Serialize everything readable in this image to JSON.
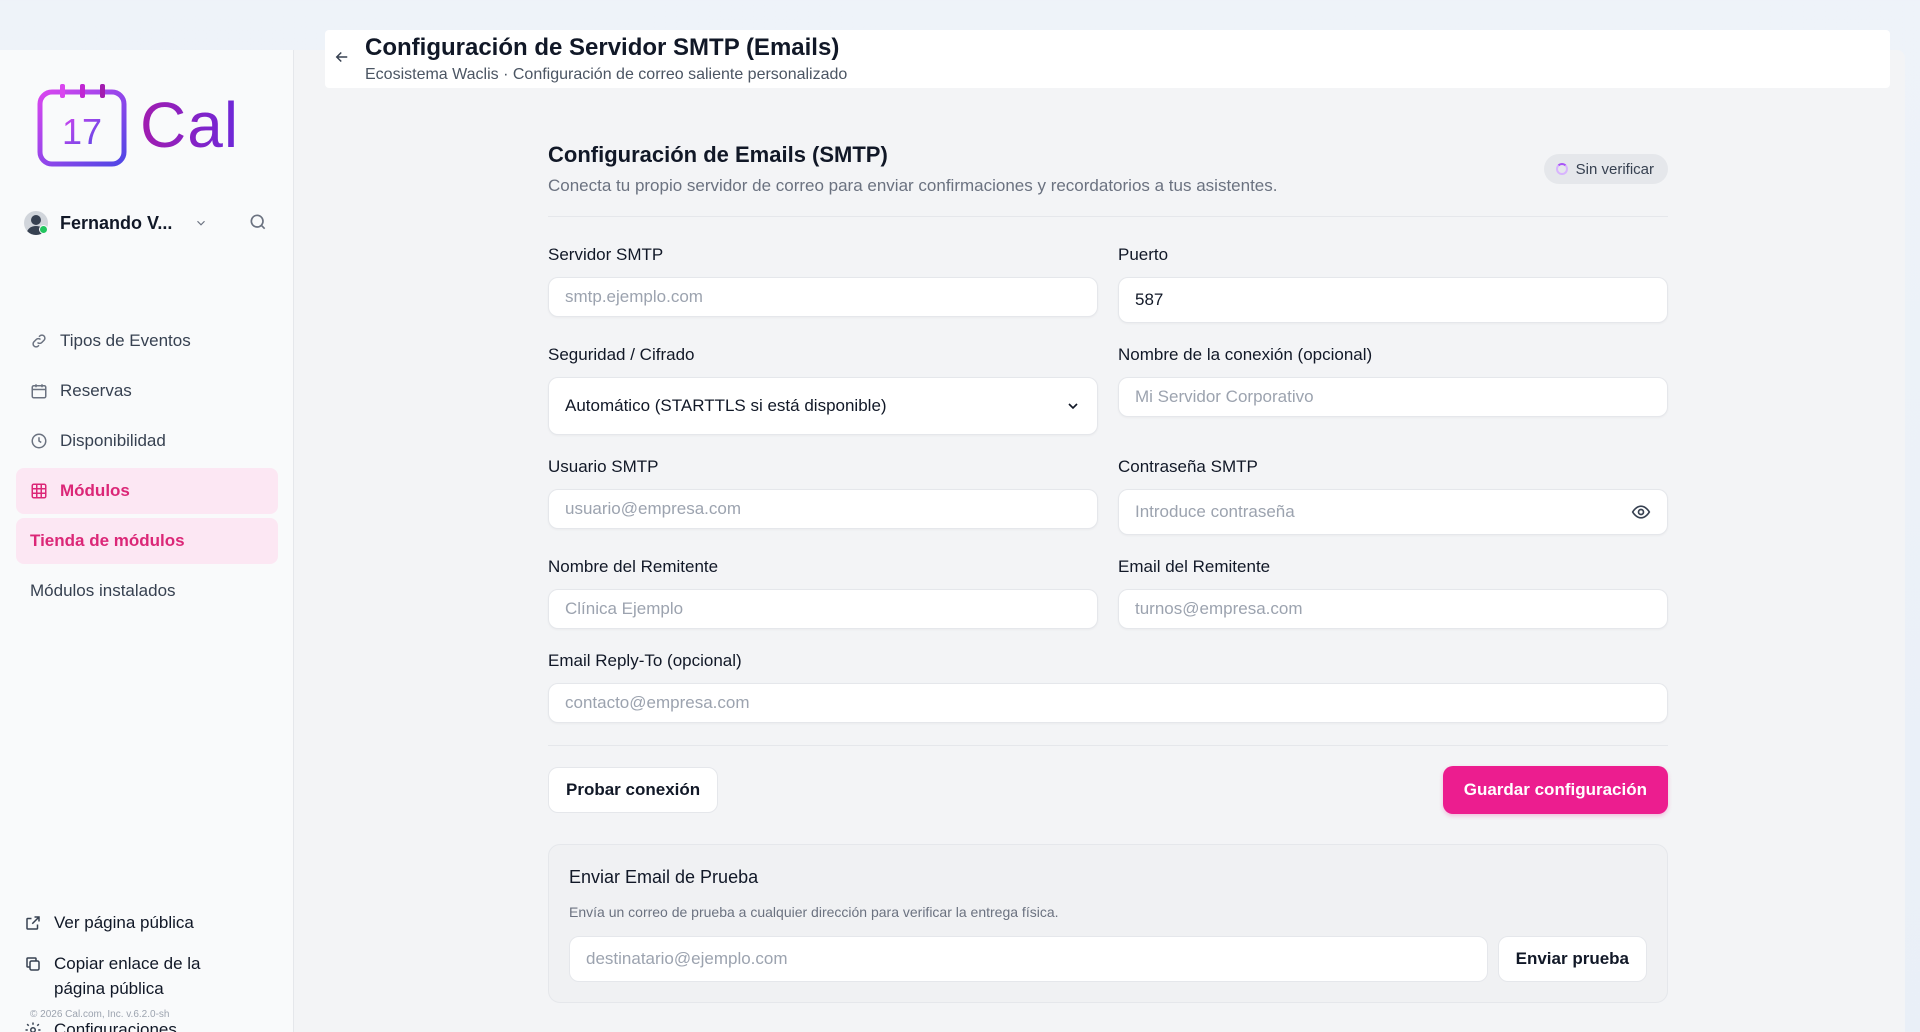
{
  "brand": {
    "name": "Cal",
    "day": "17"
  },
  "user": {
    "name": "Fernando V..."
  },
  "nav": [
    {
      "label": "Tipos de Eventos",
      "icon": "link-icon"
    },
    {
      "label": "Reservas",
      "icon": "calendar-icon"
    },
    {
      "label": "Disponibilidad",
      "icon": "clock-icon"
    },
    {
      "label": "Módulos",
      "icon": "grid-icon"
    }
  ],
  "subnav": [
    {
      "label": "Tienda de módulos"
    },
    {
      "label": "Módulos instalados"
    }
  ],
  "bottom_nav": [
    {
      "label": "Ver página pública"
    },
    {
      "label": "Copiar enlace de la página pública"
    },
    {
      "label": "Configuraciones"
    }
  ],
  "copyright": "© 2026 Cal.com, Inc. v.6.2.0-sh",
  "header": {
    "title": "Configuración de Servidor SMTP (Emails)",
    "subtitle": "Ecosistema Waclis · Configuración de correo saliente personalizado"
  },
  "section": {
    "title": "Configuración de Emails (SMTP)",
    "subtitle": "Conecta tu propio servidor de correo para enviar confirmaciones y recordatorios a tus asistentes.",
    "status": "Sin verificar"
  },
  "fields": {
    "server": {
      "label": "Servidor SMTP",
      "placeholder": "smtp.ejemplo.com"
    },
    "port": {
      "label": "Puerto",
      "value": "587"
    },
    "security": {
      "label": "Seguridad / Cifrado",
      "value": "Automático (STARTTLS si está disponible)"
    },
    "conn_name": {
      "label": "Nombre de la conexión (opcional)",
      "placeholder": "Mi Servidor Corporativo"
    },
    "user": {
      "label": "Usuario SMTP",
      "placeholder": "usuario@empresa.com"
    },
    "password": {
      "label": "Contraseña SMTP",
      "placeholder": "Introduce contraseña"
    },
    "sender_name": {
      "label": "Nombre del Remitente",
      "placeholder": "Clínica Ejemplo"
    },
    "sender_email": {
      "label": "Email del Remitente",
      "placeholder": "turnos@empresa.com"
    },
    "reply_to": {
      "label": "Email Reply-To (opcional)",
      "placeholder": "contacto@empresa.com"
    }
  },
  "actions": {
    "test": "Probar conexión",
    "save": "Guardar configuración"
  },
  "test_email": {
    "title": "Enviar Email de Prueba",
    "subtitle": "Envía un correo de prueba a cualquier dirección para verificar la entrega física.",
    "placeholder": "destinatario@ejemplo.com",
    "button": "Enviar prueba"
  },
  "colors": {
    "accent": "#ec1d8f",
    "accent_soft": "#fce7f3"
  }
}
